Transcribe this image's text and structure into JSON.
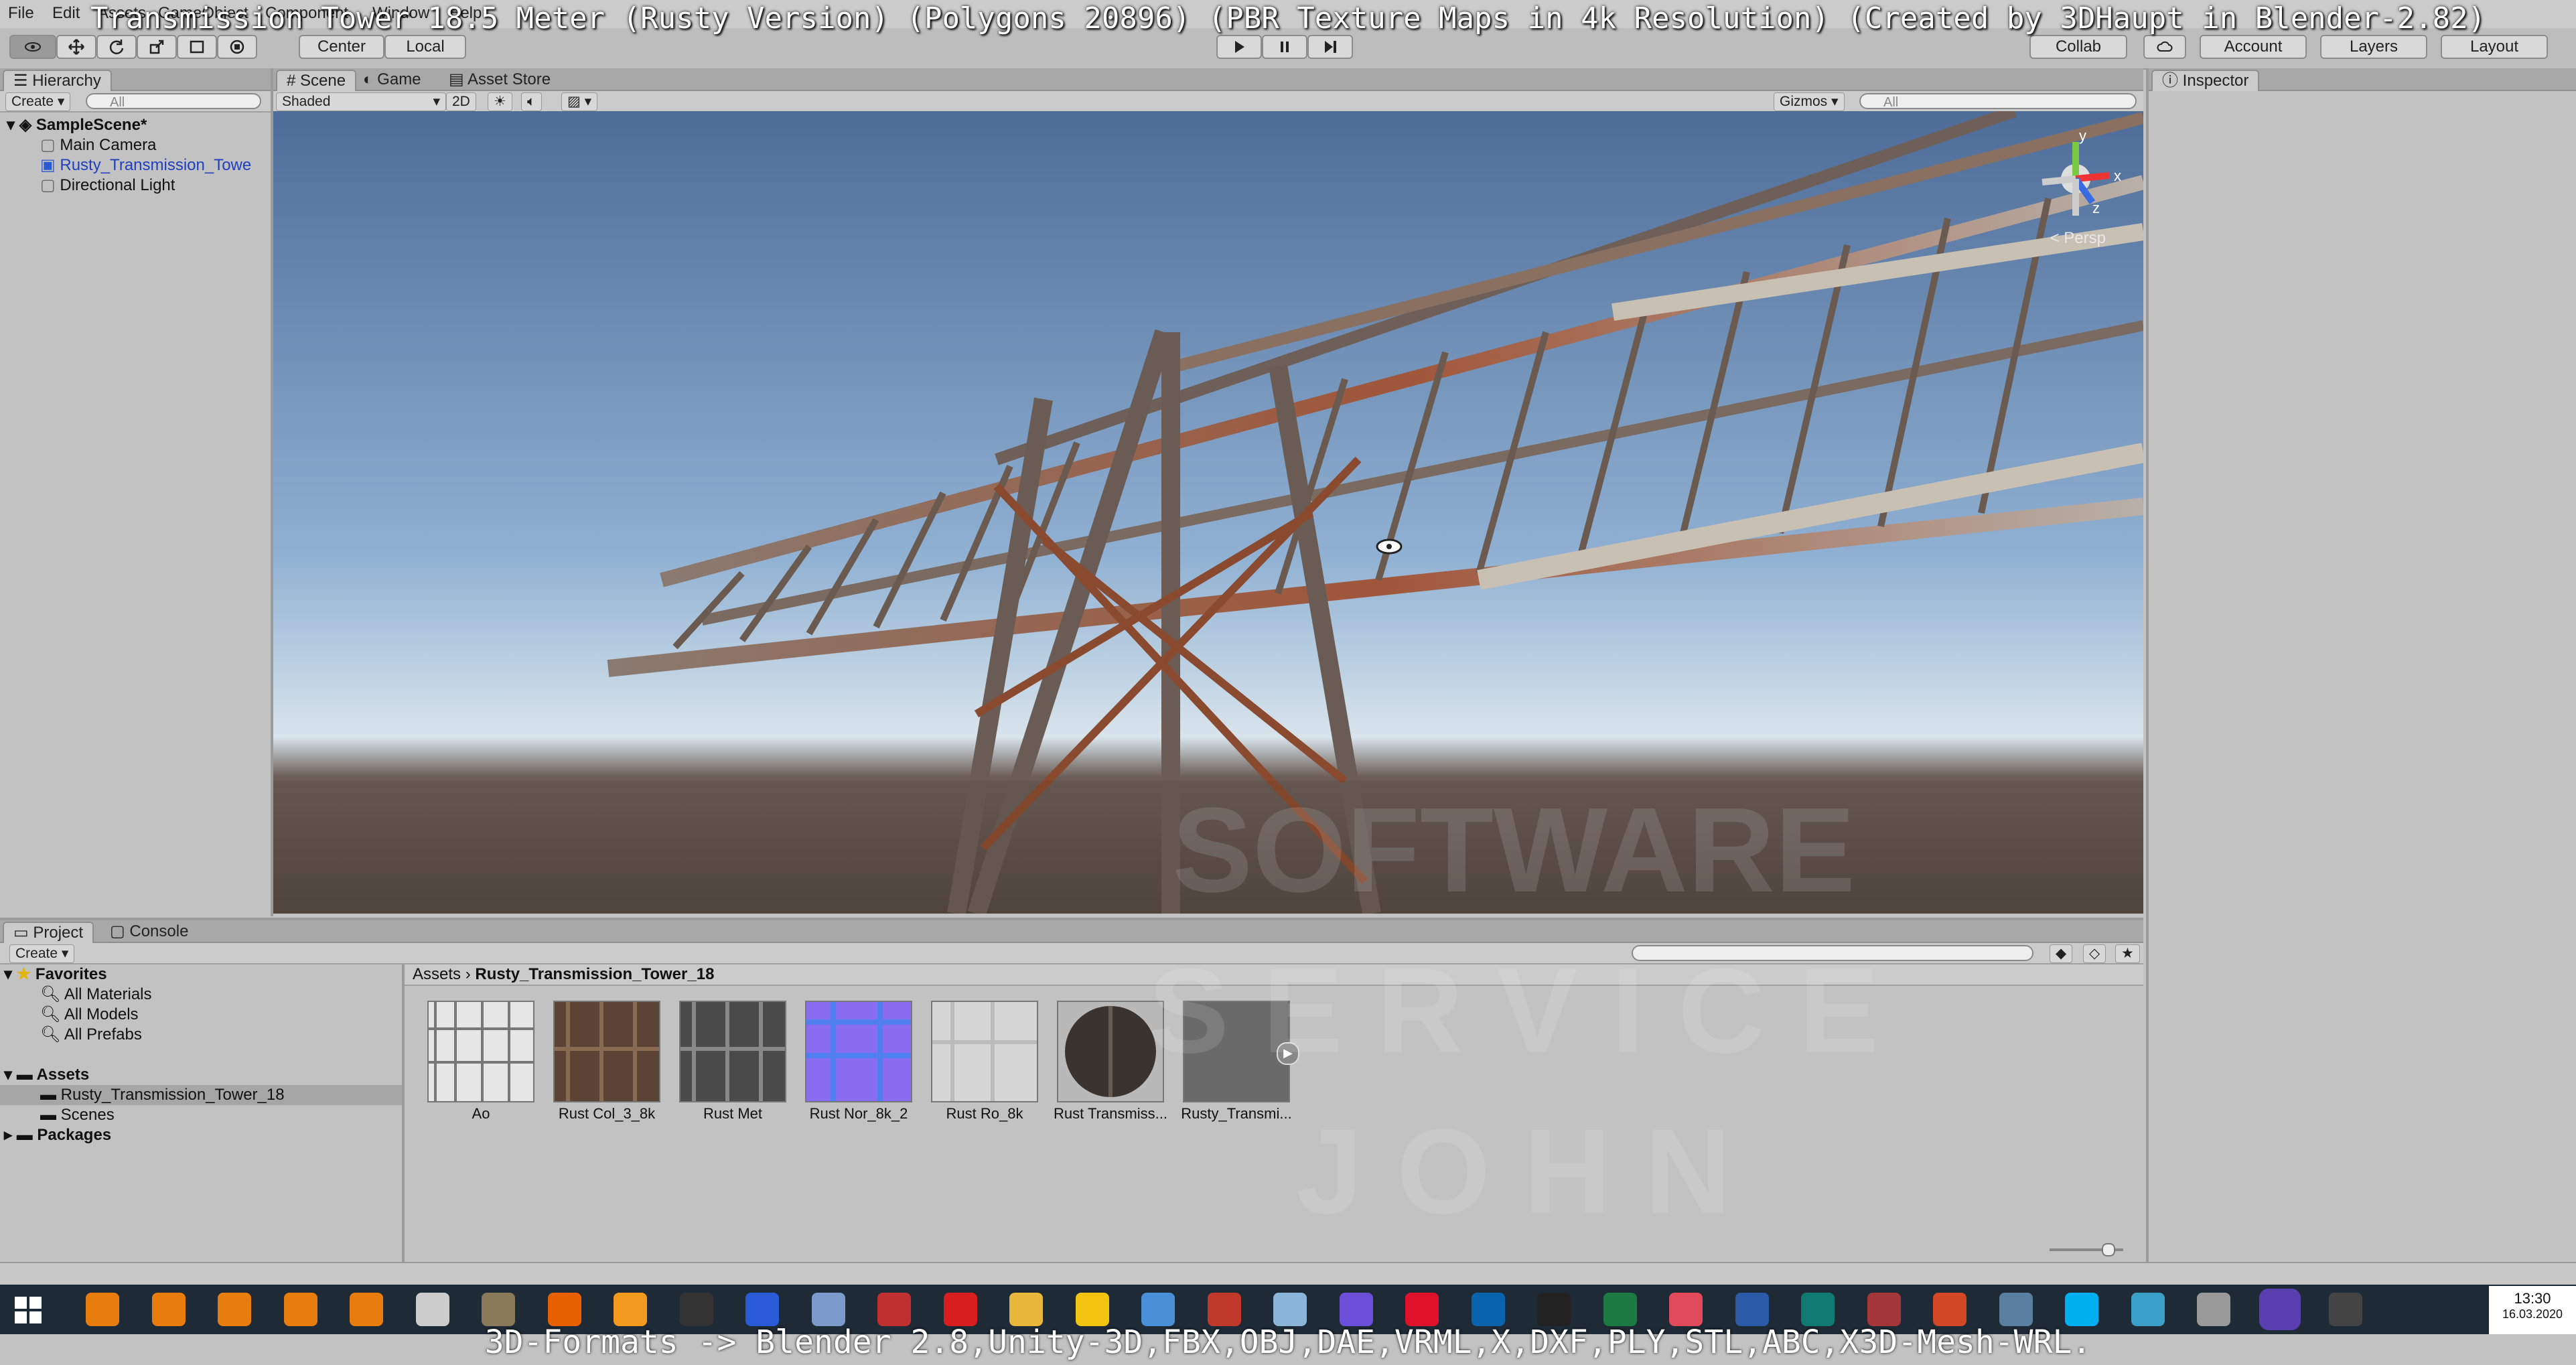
{
  "overlay_title": "Transmission Tower 18.5 Meter (Rusty Version) (Polygons 20896) (PBR Texture Maps in 4k Resolution) (Created by 3DHaupt in Blender-2.82)",
  "menu": [
    "File",
    "Edit",
    "Assets",
    "GameObject",
    "Component",
    "Window",
    "Help"
  ],
  "toolbar": {
    "pivot_center": "Center",
    "pivot_local": "Local",
    "collab": "Collab",
    "account": "Account",
    "layers": "Layers",
    "layout": "Layout"
  },
  "hierarchy": {
    "tab": "Hierarchy",
    "create": "Create",
    "search_placeholder": "All",
    "scene": "SampleScene*",
    "items": [
      "Main Camera",
      "Rusty_Transmission_Towe",
      "Directional Light"
    ]
  },
  "scene_panel": {
    "tabs": [
      "Scene",
      "Game",
      "Asset Store"
    ],
    "shading": "Shaded",
    "mode_2d": "2D",
    "gizmos": "Gizmos",
    "search_placeholder": "All",
    "persp": "< Persp",
    "gizmo_axes": {
      "x": "x",
      "y": "y",
      "z": "z"
    }
  },
  "inspector": {
    "tab": "Inspector"
  },
  "project": {
    "tabs": [
      "Project",
      "Console"
    ],
    "create": "Create",
    "favorites_label": "Favorites",
    "favorites": [
      "All Materials",
      "All Models",
      "All Prefabs"
    ],
    "assets_label": "Assets",
    "asset_folders": [
      "Rusty_Transmission_Tower_18",
      "Scenes"
    ],
    "packages_label": "Packages",
    "breadcrumb_root": "Assets",
    "breadcrumb_current": "Rusty_Transmission_Tower_18",
    "files": [
      {
        "label": "Ao",
        "color": "#e8e8e8"
      },
      {
        "label": "Rust Col_3_8k",
        "color": "#5b4436"
      },
      {
        "label": "Rust Met",
        "color": "#4a4a4a"
      },
      {
        "label": "Rust Nor_8k_2",
        "color": "#8a6cf0"
      },
      {
        "label": "Rust Ro_8k",
        "color": "#d6d6d6"
      },
      {
        "label": "Rust Transmiss...",
        "color": "#3a3430"
      },
      {
        "label": "Rusty_Transmi...",
        "color": "#6a6a6a"
      }
    ]
  },
  "watermark": {
    "line1": "SOFTWARE",
    "line2": "S E R V I C E",
    "line3": "J O H N"
  },
  "taskbar": {
    "time": "13:30",
    "date": "16.03.2020",
    "icons": [
      {
        "name": "blender-icon",
        "color": "#e87d0d"
      },
      {
        "name": "blender-icon",
        "color": "#e87d0d"
      },
      {
        "name": "blender-icon",
        "color": "#e87d0d"
      },
      {
        "name": "blender-icon",
        "color": "#e87d0d"
      },
      {
        "name": "blender-icon",
        "color": "#e87d0d"
      },
      {
        "name": "unity-icon",
        "color": "#cccccc"
      },
      {
        "name": "gimp-icon",
        "color": "#8a7a5a"
      },
      {
        "name": "firefox-icon",
        "color": "#e66000"
      },
      {
        "name": "fire-icon",
        "color": "#f29a1e"
      },
      {
        "name": "terminal-icon",
        "color": "#333333"
      },
      {
        "name": "save-icon",
        "color": "#2a5bd7"
      },
      {
        "name": "paint-icon",
        "color": "#7a9acb"
      },
      {
        "name": "bug-icon",
        "color": "#c03030"
      },
      {
        "name": "pdf-icon",
        "color": "#d81e1e"
      },
      {
        "name": "folder-icon",
        "color": "#e7b73c"
      },
      {
        "name": "x-tool-icon",
        "color": "#f1c40f"
      },
      {
        "name": "chart-icon",
        "color": "#4a90d9"
      },
      {
        "name": "cad-icon",
        "color": "#c0392b"
      },
      {
        "name": "notepad-icon",
        "color": "#8ab4d8"
      },
      {
        "name": "gem-icon",
        "color": "#6b4fd8"
      },
      {
        "name": "opera-icon",
        "color": "#e0122b"
      },
      {
        "name": "outlook-icon",
        "color": "#0a64ad"
      },
      {
        "name": "edge-icon",
        "color": "#222222"
      },
      {
        "name": "excel-icon",
        "color": "#1d7a43"
      },
      {
        "name": "vector-icon",
        "color": "#e04a5a"
      },
      {
        "name": "word-icon",
        "color": "#2a5aa8"
      },
      {
        "name": "publisher-icon",
        "color": "#0f7a72"
      },
      {
        "name": "access-icon",
        "color": "#a4373a"
      },
      {
        "name": "powerpoint-icon",
        "color": "#d24726"
      },
      {
        "name": "monitor-icon",
        "color": "#5a7fa0"
      },
      {
        "name": "skype-icon",
        "color": "#00aff0"
      },
      {
        "name": "pen-icon",
        "color": "#3aa0c8"
      },
      {
        "name": "unity-hub-icon",
        "color": "#9a9a9a"
      },
      {
        "name": "unity-editor-icon",
        "color": "#ffffff"
      },
      {
        "name": "obs-icon",
        "color": "#444444"
      }
    ]
  },
  "bottom_caption": "3D-Formats -> Blender 2.8,Unity-3D,FBX,OBJ,DAE,VRML,X,DXF,PLY,STL,ABC,X3D-Mesh-WRL."
}
